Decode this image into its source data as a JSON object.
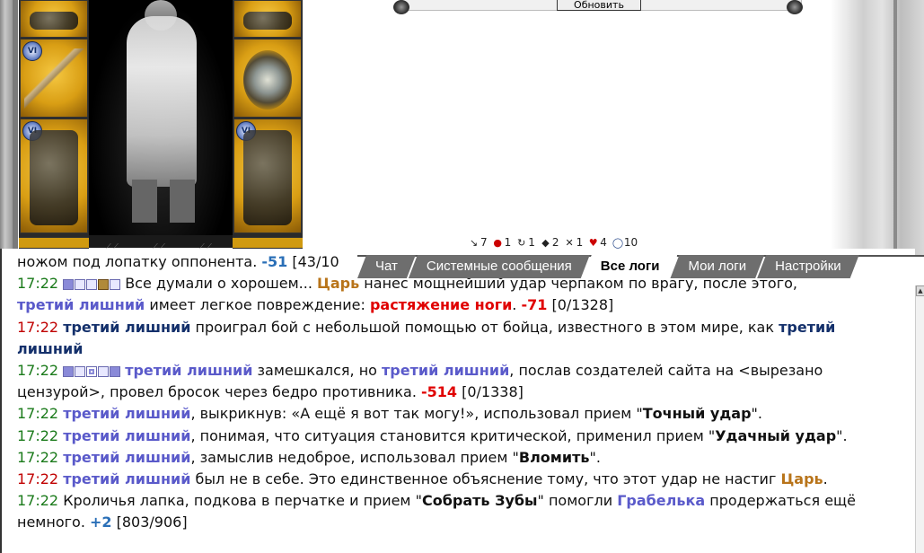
{
  "header": {
    "refresh_button": "Обновить"
  },
  "equipment": {
    "left_slots": [
      {
        "badge": "",
        "item_icon": "bracers-icon"
      },
      {
        "badge": "VI",
        "item_icon": "mace-icon"
      },
      {
        "badge": "VI",
        "item_icon": "armor-icon"
      },
      {
        "badge": "VI",
        "item_icon": "slot-icon"
      }
    ],
    "right_slots": [
      {
        "badge": "",
        "item_icon": "gloves-icon"
      },
      {
        "badge": "",
        "item_icon": "spiked-shield-icon"
      },
      {
        "badge": "VI",
        "item_icon": "greaves-icon"
      },
      {
        "badge": "VI",
        "item_icon": "slot-icon"
      }
    ]
  },
  "stats": [
    {
      "icon": "sword-icon",
      "glyph": "↘",
      "value": "7"
    },
    {
      "icon": "blood-drop-icon",
      "glyph": "●",
      "value": "1",
      "color": "#cc0000"
    },
    {
      "icon": "swirl-icon",
      "glyph": "↻",
      "value": "1"
    },
    {
      "icon": "shield-icon",
      "glyph": "◆",
      "value": "2"
    },
    {
      "icon": "crossed-swords-icon",
      "glyph": "✕",
      "value": "1"
    },
    {
      "icon": "heart-icon",
      "glyph": "♥",
      "value": "4",
      "color": "#cc0000"
    },
    {
      "icon": "defense-icon",
      "glyph": "◯",
      "value": "10",
      "color": "#2a4a8a"
    }
  ],
  "tabs": [
    {
      "label": "Чат",
      "active": false
    },
    {
      "label": "Системные сообщения",
      "active": false
    },
    {
      "label": "Все логи",
      "active": true
    },
    {
      "label": "Мои логи",
      "active": false
    },
    {
      "label": "Настройки",
      "active": false
    }
  ],
  "log": {
    "l0": {
      "text": "ножом под лопатку оппонента. ",
      "dmg": "-51",
      "hp": " [43/10"
    },
    "l1": {
      "time": "17:22",
      "t1": "Все думали о хорошем... ",
      "tsar": "Царь",
      "t2": " нанес мощнейший удар черпаком по врагу, после этого,"
    },
    "l1b": {
      "nick": "третий лишний",
      "t1": " имеет легкое повреждение: ",
      "injury": "растяжение ноги",
      "t2": ". ",
      "dmg": "-71",
      "hp": " [0/1328]"
    },
    "l2": {
      "time": "17:22",
      "nick1": "третий лишний",
      "t1": " проиграл бой с небольшой помощью от бойца, известного в этом мире, как ",
      "nick2": "третий"
    },
    "l2b": {
      "nick2b": "лишний"
    },
    "l3": {
      "time": "17:22",
      "nick1": "третий лишний",
      "t1": " замешкался, но ",
      "nick2": "третий лишний",
      "t2": ", послав создателей сайта на <вырезано"
    },
    "l3b": {
      "t1": "цензурой>, провел бросок через бедро противника. ",
      "dmg": "-514",
      "hp": " [0/1338]"
    },
    "l4": {
      "time": "17:22",
      "nick": "третий лишний",
      "t1": ", выкрикнув: «А ещё я вот так могу!», использовал прием \"",
      "skill": "Точный удар",
      "t2": "\"."
    },
    "l5": {
      "time": "17:22",
      "nick": "третий лишний",
      "t1": ", понимая, что ситуация становится критической, применил прием \"",
      "skill": "Удачный удар",
      "t2": "\"."
    },
    "l6": {
      "time": "17:22",
      "nick": "третий лишний",
      "t1": ", замыслив недоброе, использовал прием \"",
      "skill": "Вломить",
      "t2": "\"."
    },
    "l7": {
      "time": "17:22",
      "nick": "третий лишний",
      "t1": " был не в себе. Это единственное объяснение тому, что этот удар не настиг ",
      "tsar": "Царь",
      "t2": "."
    },
    "l8": {
      "time": "17:22",
      "t1": " Кроличья лапка, подкова в перчатке и прием \"",
      "skill": "Собрать Зубы",
      "t2": "\" помогли ",
      "nick": "Грабелька",
      "t3": " продержаться ещё"
    },
    "l8b": {
      "t1": "немного. ",
      "heal": "+2",
      "hp": " [803/906]"
    }
  }
}
